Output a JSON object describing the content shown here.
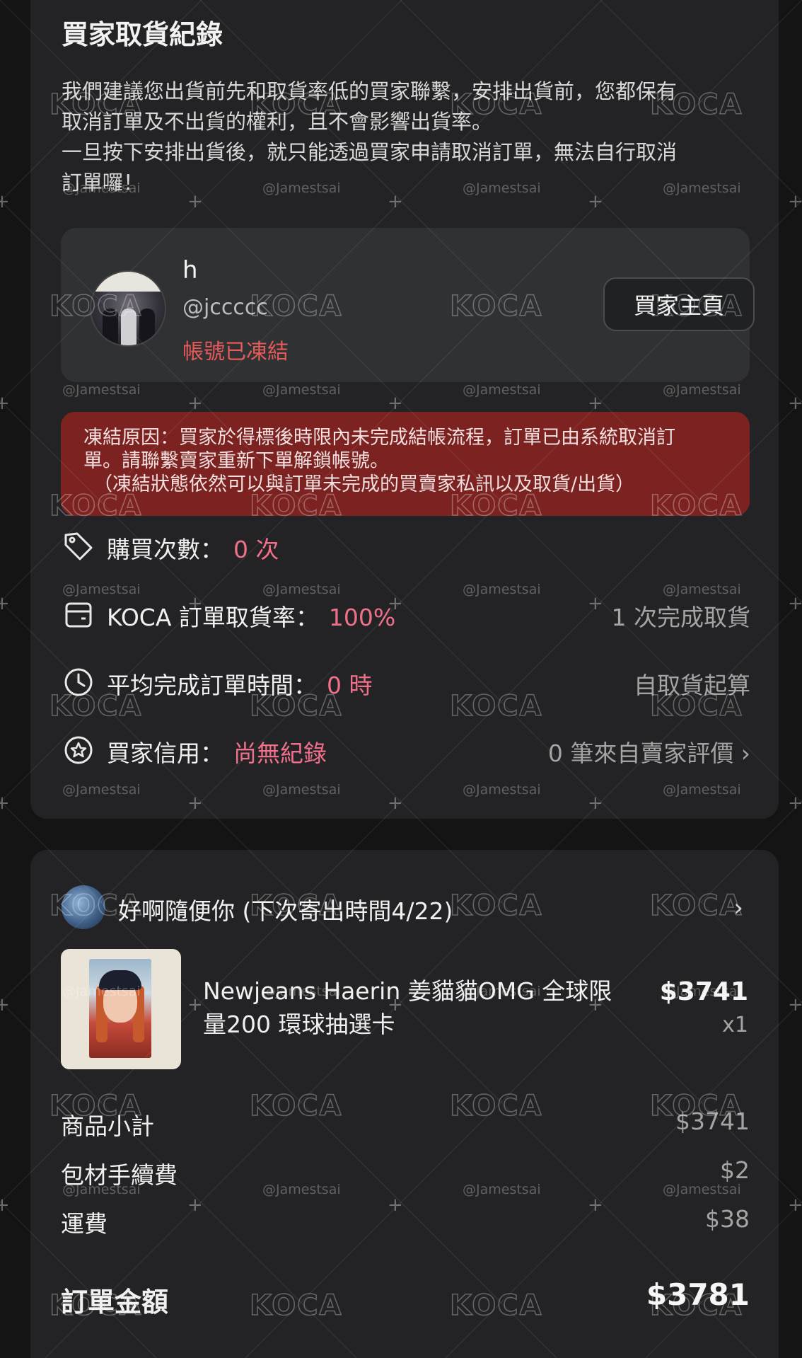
{
  "order_section": {
    "title": "買家取貨紀錄",
    "notice_lines": [
      "我們建議您出貨前先和取貨率低的買家聯繫，安排出貨前，您都保有",
      "取消訂單及不出貨的權利，且不會影響出貨率。",
      "一旦按下安排出貨後，就只能透過買家申請取消訂單，無法自行取消",
      "訂單囉！"
    ]
  },
  "buyer": {
    "name": "h",
    "handle": "@jccccc",
    "status": "帳號已凍結",
    "home_button": "買家主頁"
  },
  "freeze_notice": {
    "line1": "凍結原因：買家於得標後時限內未完成結帳流程，訂單已由系統取消訂",
    "line2": "單。請聯繫賣家重新下單解鎖帳號。",
    "line3": "（凍結狀態依然可以與訂單未完成的買賣家私訊以及取貨/出貨）"
  },
  "stats": [
    {
      "icon": "tag-icon",
      "label": "購買次數：",
      "value": "0 次",
      "right": ""
    },
    {
      "icon": "box-icon",
      "label": "KOCA 訂單取貨率：",
      "value": "100%",
      "right": "1 次完成取貨"
    },
    {
      "icon": "clock-icon",
      "label": "平均完成訂單時間：",
      "value": "0 時",
      "right": "自取貨起算"
    },
    {
      "icon": "star-badge-icon",
      "label": "買家信用：",
      "value": "尚無紀錄",
      "right": "0 筆來自賣家評價 ›"
    }
  ],
  "order": {
    "seller_name": "好啊隨便你 (下次寄出時間4/22)",
    "product_title_line1": "Newjeans Haerin 姜貓貓OMG 全球限",
    "product_title_line2": "量200 環球抽選卡",
    "price": "$3741",
    "qty": "x1",
    "subtotal_label": "商品小計",
    "subtotal": "$3741",
    "packing_label": "包材手續費",
    "packing": "$2",
    "shipping_label": "運費",
    "shipping": "$38",
    "total_label": "訂單金額",
    "total": "$3781"
  },
  "watermark": {
    "logo": "KOCA",
    "handle": "@Jamestsai"
  },
  "colors": {
    "accent_pink": "#f0708b",
    "frozen_red": "#e65a5a",
    "freeze_bg": "#7c2322",
    "card_bg": "#232325"
  }
}
